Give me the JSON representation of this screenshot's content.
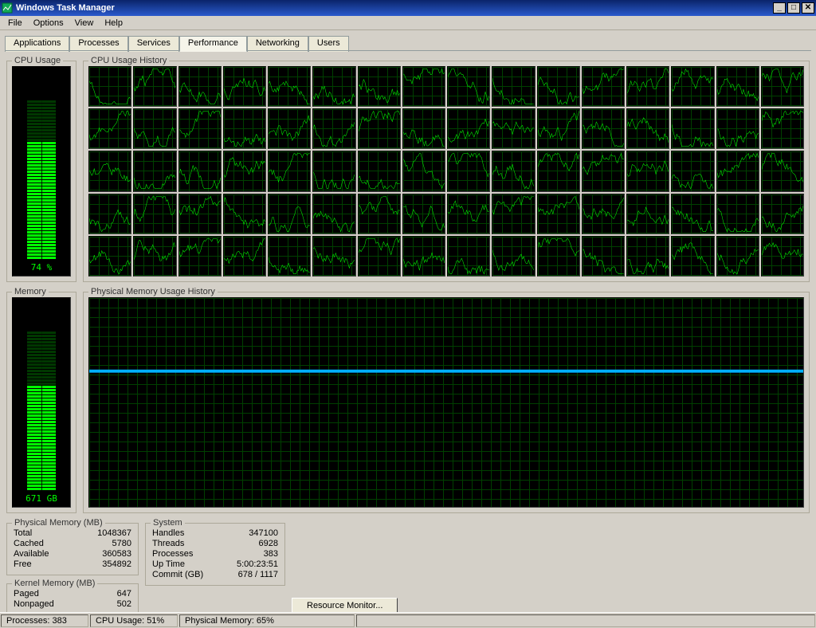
{
  "window": {
    "title": "Windows Task Manager"
  },
  "menu": {
    "file": "File",
    "options": "Options",
    "view": "View",
    "help": "Help"
  },
  "tabs": {
    "applications": "Applications",
    "processes": "Processes",
    "services": "Services",
    "performance": "Performance",
    "networking": "Networking",
    "users": "Users"
  },
  "group_labels": {
    "cpu_usage": "CPU Usage",
    "cpu_history": "CPU Usage History",
    "memory": "Memory",
    "mem_history": "Physical Memory Usage History",
    "phys_mem": "Physical Memory (MB)",
    "kernel_mem": "Kernel Memory (MB)",
    "system": "System"
  },
  "cpu_gauge_label": "74 %",
  "memory_gauge_label": "671 GB",
  "phys_mem": {
    "total_label": "Total",
    "total": "1048367",
    "cached_label": "Cached",
    "cached": "5780",
    "available_label": "Available",
    "available": "360583",
    "free_label": "Free",
    "free": "354892"
  },
  "kernel_mem": {
    "paged_label": "Paged",
    "paged": "647",
    "nonpaged_label": "Nonpaged",
    "nonpaged": "502"
  },
  "system": {
    "handles_label": "Handles",
    "handles": "347100",
    "threads_label": "Threads",
    "threads": "6928",
    "processes_label": "Processes",
    "processes": "383",
    "uptime_label": "Up Time",
    "uptime": "5:00:23:51",
    "commit_label": "Commit (GB)",
    "commit": "678 / 1117"
  },
  "buttons": {
    "resource_monitor": "Resource Monitor..."
  },
  "statusbar": {
    "processes": "Processes: 383",
    "cpu": "CPU Usage: 51%",
    "mem": "Physical Memory: 65%"
  },
  "chart_data": {
    "cpu_gauge": {
      "type": "bar",
      "percent": 74,
      "title": "CPU Usage",
      "ylim": [
        0,
        100
      ]
    },
    "memory_gauge": {
      "type": "bar",
      "percent": 65,
      "value_gb": 671,
      "total_gb": 1024,
      "title": "Memory",
      "ylim": [
        0,
        100
      ]
    },
    "cpu_history": {
      "type": "line",
      "cores": 80,
      "title": "CPU Usage History",
      "ylim": [
        0,
        100
      ],
      "note": "per-core recent CPU% trace, highly variable ~30-95%"
    },
    "memory_history": {
      "type": "line",
      "title": "Physical Memory Usage History",
      "ylim": [
        0,
        100
      ],
      "value_percent_flat": 65
    }
  }
}
